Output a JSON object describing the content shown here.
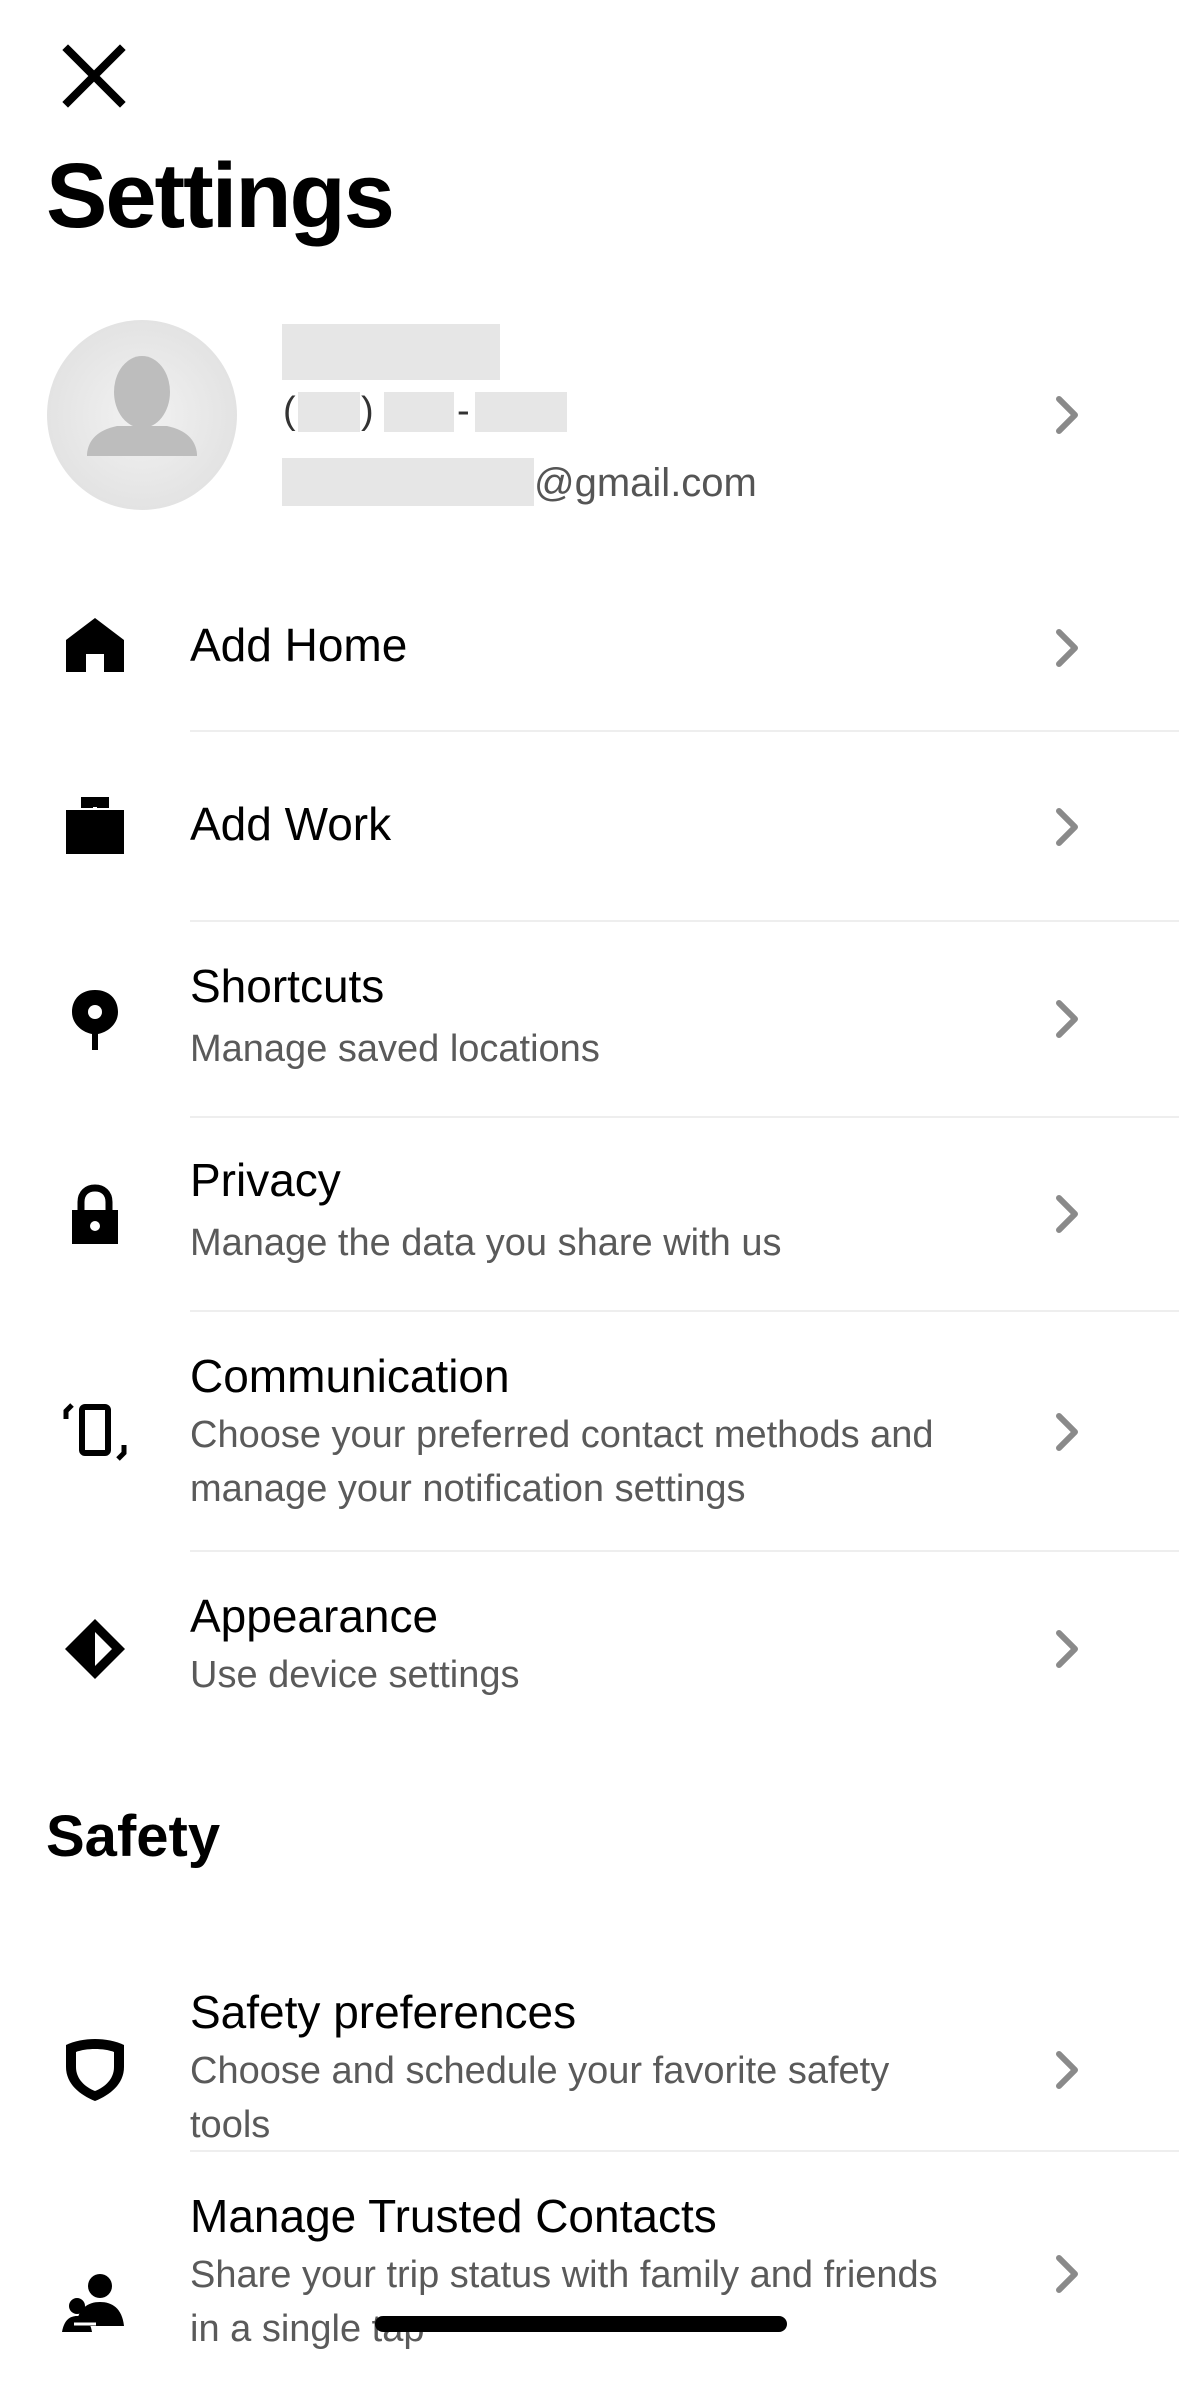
{
  "header": {
    "title": "Settings"
  },
  "profile": {
    "phone_open": "(",
    "phone_close": ")",
    "phone_dash": "-",
    "email_suffix": "@gmail.com"
  },
  "items": [
    {
      "title": "Add Home",
      "subtitle": ""
    },
    {
      "title": "Add Work",
      "subtitle": ""
    },
    {
      "title": "Shortcuts",
      "subtitle": "Manage saved locations"
    },
    {
      "title": "Privacy",
      "subtitle": "Manage the data you share with us"
    },
    {
      "title": "Communication",
      "subtitle": "Choose your preferred contact methods and manage your notification settings"
    },
    {
      "title": "Appearance",
      "subtitle": "Use device settings"
    }
  ],
  "safety": {
    "title": "Safety",
    "items": [
      {
        "title": "Safety preferences",
        "subtitle": "Choose and schedule your favorite safety tools"
      },
      {
        "title": "Manage Trusted Contacts",
        "subtitle": "Share your trip status with family and friends in a single tap"
      }
    ]
  },
  "icons": {
    "close": "close-icon",
    "home": "home-icon",
    "work": "briefcase-icon",
    "shortcuts": "location-pin-icon",
    "privacy": "lock-icon",
    "communication": "phone-ringing-icon",
    "appearance": "contrast-diamond-icon",
    "safety": "shield-icon",
    "contacts": "people-icon",
    "chevron": "chevron-right-icon"
  },
  "colors": {
    "text": "#000000",
    "subtext": "#5a5a5a",
    "divider": "#eeeeee",
    "chevron": "#8a8a8a",
    "redaction": "#e6e6e6"
  }
}
